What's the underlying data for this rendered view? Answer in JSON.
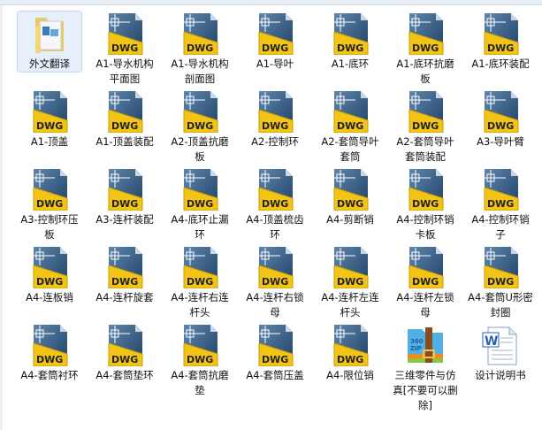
{
  "items": [
    {
      "label": "外文翻译",
      "type": "folder",
      "selected": true
    },
    {
      "label": "A1-导水机构平面图",
      "type": "dwg"
    },
    {
      "label": "A1-导水机构剖面图",
      "type": "dwg"
    },
    {
      "label": "A1-导叶",
      "type": "dwg"
    },
    {
      "label": "A1-底环",
      "type": "dwg"
    },
    {
      "label": "A1-底环抗磨板",
      "type": "dwg"
    },
    {
      "label": "A1-底环装配",
      "type": "dwg"
    },
    {
      "label": "A1-顶盖",
      "type": "dwg"
    },
    {
      "label": "A1-顶盖装配",
      "type": "dwg"
    },
    {
      "label": "A2-顶盖抗磨板",
      "type": "dwg"
    },
    {
      "label": "A2-控制环",
      "type": "dwg"
    },
    {
      "label": "A2-套筒导叶套筒",
      "type": "dwg"
    },
    {
      "label": "A2-套筒导叶套筒装配",
      "type": "dwg"
    },
    {
      "label": "A3-导叶臂",
      "type": "dwg"
    },
    {
      "label": "A3-控制环压板",
      "type": "dwg"
    },
    {
      "label": "A3-连杆装配",
      "type": "dwg"
    },
    {
      "label": "A4-底环止漏环",
      "type": "dwg"
    },
    {
      "label": "A4-顶盖梳齿环",
      "type": "dwg"
    },
    {
      "label": "A4-剪断销",
      "type": "dwg"
    },
    {
      "label": "A4-控制环销卡板",
      "type": "dwg"
    },
    {
      "label": "A4-控制环销子",
      "type": "dwg"
    },
    {
      "label": "A4-连板销",
      "type": "dwg"
    },
    {
      "label": "A4-连杆旋套",
      "type": "dwg"
    },
    {
      "label": "A4-连杆右连杆头",
      "type": "dwg"
    },
    {
      "label": "A4-连杆右锁母",
      "type": "dwg"
    },
    {
      "label": "A4-连杆左连杆头",
      "type": "dwg"
    },
    {
      "label": "A4-连杆左锁母",
      "type": "dwg"
    },
    {
      "label": "A4-套筒U形密封圈",
      "type": "dwg"
    },
    {
      "label": "A4-套筒衬环",
      "type": "dwg"
    },
    {
      "label": "A4-套筒垫环",
      "type": "dwg"
    },
    {
      "label": "A4-套筒抗磨垫",
      "type": "dwg"
    },
    {
      "label": "A4-套筒压盖",
      "type": "dwg"
    },
    {
      "label": "A4-限位销",
      "type": "dwg"
    },
    {
      "label": "三维零件与仿真[不要可以删除]",
      "type": "zip"
    },
    {
      "label": "设计说明书",
      "type": "word"
    }
  ],
  "icon_text": {
    "dwg": "DWG",
    "zip_top": "360",
    "zip_bottom": "ZIP",
    "word": "W"
  }
}
